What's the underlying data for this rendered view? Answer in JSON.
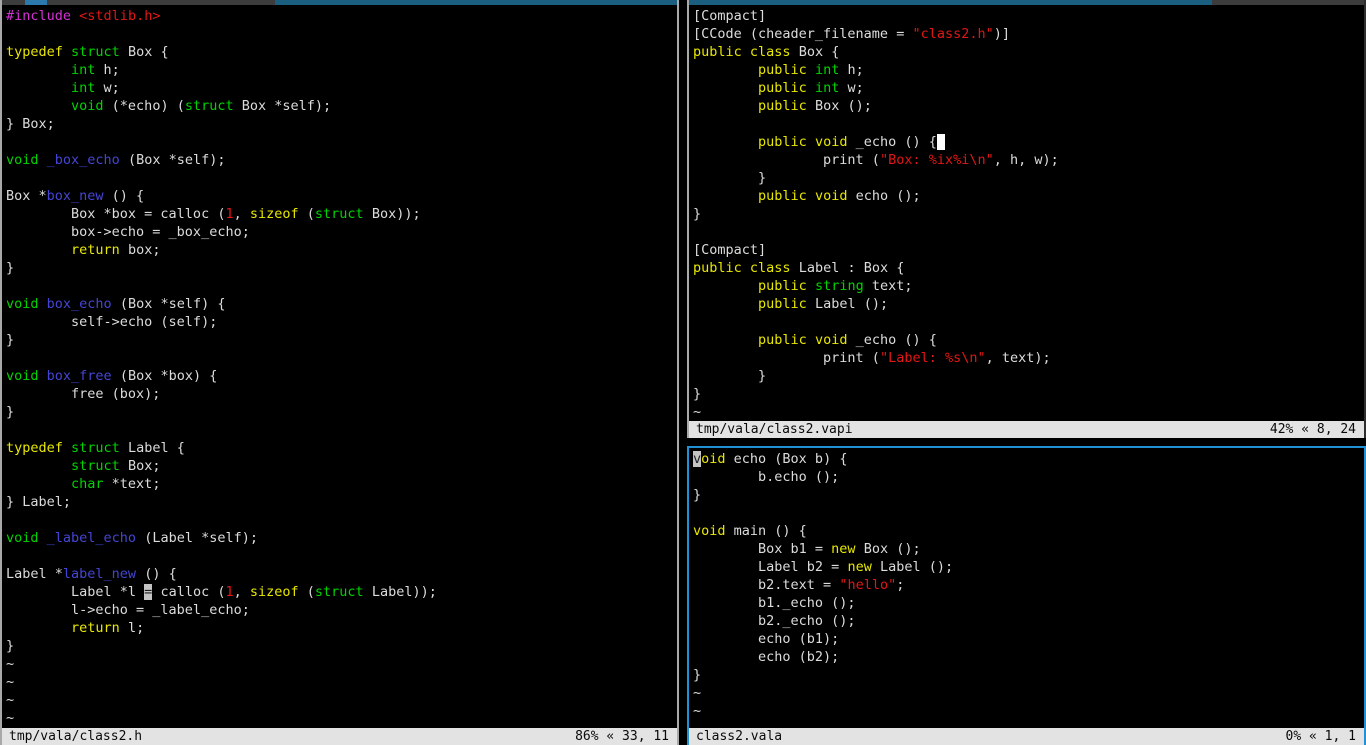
{
  "colors": {
    "background": "#000000",
    "default_text": "#dcdcdc",
    "syntax_magenta": "#d431d4",
    "syntax_red": "#e31616",
    "syntax_yellow": "#e8e800",
    "syntax_green": "#00d400",
    "syntax_blue": "#4545d5",
    "statusbar_bg": "#e3e3e3",
    "statusbar_text": "#0a0a0a",
    "active_pane_border": "#2191d6",
    "inactive_pane_border": "#a9a9a9",
    "top_strip_teal": "#1b5f80",
    "top_strip_blue": "#2b79ad",
    "top_strip_gray": "#3c3c3c",
    "cursor_inactive": "#c4c4c4",
    "cursor_active": "#ffffff"
  },
  "panes": {
    "left": {
      "status": {
        "file": "tmp/vala/class2.h",
        "position": "86% « 33, 11"
      },
      "lines": [
        [
          {
            "t": "#include",
            "c": "magenta"
          },
          {
            "t": " ",
            "c": "fg"
          },
          {
            "t": "<stdlib.h>",
            "c": "red"
          }
        ],
        [],
        [
          {
            "t": "typedef",
            "c": "yellow"
          },
          {
            "t": " ",
            "c": "fg"
          },
          {
            "t": "struct",
            "c": "green"
          },
          {
            "t": " Box {",
            "c": "fg"
          }
        ],
        [
          {
            "t": "        ",
            "c": "fg"
          },
          {
            "t": "int",
            "c": "green"
          },
          {
            "t": " h;",
            "c": "fg"
          }
        ],
        [
          {
            "t": "        ",
            "c": "fg"
          },
          {
            "t": "int",
            "c": "green"
          },
          {
            "t": " w;",
            "c": "fg"
          }
        ],
        [
          {
            "t": "        ",
            "c": "fg"
          },
          {
            "t": "void",
            "c": "green"
          },
          {
            "t": " (*echo) (",
            "c": "fg"
          },
          {
            "t": "struct",
            "c": "green"
          },
          {
            "t": " Box *self);",
            "c": "fg"
          }
        ],
        [
          {
            "t": "} Box;",
            "c": "fg"
          }
        ],
        [],
        [
          {
            "t": "void",
            "c": "green"
          },
          {
            "t": " ",
            "c": "fg"
          },
          {
            "t": "_box_echo",
            "c": "blue"
          },
          {
            "t": " (Box *self);",
            "c": "fg"
          }
        ],
        [],
        [
          {
            "t": "Box *",
            "c": "fg"
          },
          {
            "t": "box_new",
            "c": "blue"
          },
          {
            "t": " () {",
            "c": "fg"
          }
        ],
        [
          {
            "t": "        Box *box = calloc (",
            "c": "fg"
          },
          {
            "t": "1",
            "c": "red"
          },
          {
            "t": ", ",
            "c": "fg"
          },
          {
            "t": "sizeof",
            "c": "yellow"
          },
          {
            "t": " (",
            "c": "fg"
          },
          {
            "t": "struct",
            "c": "green"
          },
          {
            "t": " Box));",
            "c": "fg"
          }
        ],
        [
          {
            "t": "        box->echo = _box_echo;",
            "c": "fg"
          }
        ],
        [
          {
            "t": "        ",
            "c": "fg"
          },
          {
            "t": "return",
            "c": "yellow"
          },
          {
            "t": " box;",
            "c": "fg"
          }
        ],
        [
          {
            "t": "}",
            "c": "fg"
          }
        ],
        [],
        [
          {
            "t": "void",
            "c": "green"
          },
          {
            "t": " ",
            "c": "fg"
          },
          {
            "t": "box_echo",
            "c": "blue"
          },
          {
            "t": " (Box *self) {",
            "c": "fg"
          }
        ],
        [
          {
            "t": "        self->echo (self);",
            "c": "fg"
          }
        ],
        [
          {
            "t": "}",
            "c": "fg"
          }
        ],
        [],
        [
          {
            "t": "void",
            "c": "green"
          },
          {
            "t": " ",
            "c": "fg"
          },
          {
            "t": "box_free",
            "c": "blue"
          },
          {
            "t": " (Box *box) {",
            "c": "fg"
          }
        ],
        [
          {
            "t": "        free (box);",
            "c": "fg"
          }
        ],
        [
          {
            "t": "}",
            "c": "fg"
          }
        ],
        [],
        [
          {
            "t": "typedef",
            "c": "yellow"
          },
          {
            "t": " ",
            "c": "fg"
          },
          {
            "t": "struct",
            "c": "green"
          },
          {
            "t": " Label {",
            "c": "fg"
          }
        ],
        [
          {
            "t": "        ",
            "c": "fg"
          },
          {
            "t": "struct",
            "c": "green"
          },
          {
            "t": " Box;",
            "c": "fg"
          }
        ],
        [
          {
            "t": "        ",
            "c": "fg"
          },
          {
            "t": "char",
            "c": "green"
          },
          {
            "t": " *text;",
            "c": "fg"
          }
        ],
        [
          {
            "t": "} Label;",
            "c": "fg"
          }
        ],
        [],
        [
          {
            "t": "void",
            "c": "green"
          },
          {
            "t": " ",
            "c": "fg"
          },
          {
            "t": "_label_echo",
            "c": "blue"
          },
          {
            "t": " (Label *self);",
            "c": "fg"
          }
        ],
        [],
        [
          {
            "t": "Label *",
            "c": "fg"
          },
          {
            "t": "label_new",
            "c": "blue"
          },
          {
            "t": " () {",
            "c": "fg"
          }
        ],
        [
          {
            "t": "        Label *l ",
            "c": "fg"
          },
          {
            "t": "=",
            "c": "fg",
            "cursor": "gray"
          },
          {
            "t": " calloc (",
            "c": "fg"
          },
          {
            "t": "1",
            "c": "red"
          },
          {
            "t": ", ",
            "c": "fg"
          },
          {
            "t": "sizeof",
            "c": "yellow"
          },
          {
            "t": " (",
            "c": "fg"
          },
          {
            "t": "struct",
            "c": "green"
          },
          {
            "t": " Label));",
            "c": "fg"
          }
        ],
        [
          {
            "t": "        l->echo = _label_echo;",
            "c": "fg"
          }
        ],
        [
          {
            "t": "        ",
            "c": "fg"
          },
          {
            "t": "return",
            "c": "yellow"
          },
          {
            "t": " l;",
            "c": "fg"
          }
        ],
        [
          {
            "t": "}",
            "c": "fg"
          }
        ],
        [
          {
            "t": "~",
            "c": "fg"
          }
        ],
        [
          {
            "t": "~",
            "c": "fg"
          }
        ],
        [
          {
            "t": "~",
            "c": "fg"
          }
        ],
        [
          {
            "t": "~",
            "c": "fg"
          }
        ]
      ]
    },
    "top_right": {
      "status": {
        "file": "tmp/vala/class2.vapi",
        "position": "42% « 8, 24"
      },
      "lines": [
        [
          {
            "t": "[Compact]",
            "c": "fg"
          }
        ],
        [
          {
            "t": "[CCode (cheader_filename = ",
            "c": "fg"
          },
          {
            "t": "\"class2.h\"",
            "c": "red"
          },
          {
            "t": ")]",
            "c": "fg"
          }
        ],
        [
          {
            "t": "public",
            "c": "yellow"
          },
          {
            "t": " ",
            "c": "fg"
          },
          {
            "t": "class",
            "c": "yellow"
          },
          {
            "t": " Box {",
            "c": "fg"
          }
        ],
        [
          {
            "t": "        ",
            "c": "fg"
          },
          {
            "t": "public",
            "c": "yellow"
          },
          {
            "t": " ",
            "c": "fg"
          },
          {
            "t": "int",
            "c": "green"
          },
          {
            "t": " h;",
            "c": "fg"
          }
        ],
        [
          {
            "t": "        ",
            "c": "fg"
          },
          {
            "t": "public",
            "c": "yellow"
          },
          {
            "t": " ",
            "c": "fg"
          },
          {
            "t": "int",
            "c": "green"
          },
          {
            "t": " w;",
            "c": "fg"
          }
        ],
        [
          {
            "t": "        ",
            "c": "fg"
          },
          {
            "t": "public",
            "c": "yellow"
          },
          {
            "t": " Box ();",
            "c": "fg"
          }
        ],
        [],
        [
          {
            "t": "        ",
            "c": "fg"
          },
          {
            "t": "public",
            "c": "yellow"
          },
          {
            "t": " ",
            "c": "fg"
          },
          {
            "t": "void",
            "c": "yellow"
          },
          {
            "t": " _echo () {",
            "c": "fg"
          },
          {
            "t": " ",
            "c": "fg",
            "cursor": "white"
          }
        ],
        [
          {
            "t": "                print (",
            "c": "fg"
          },
          {
            "t": "\"Box: %ix%i\\n\"",
            "c": "red"
          },
          {
            "t": ", h, w);",
            "c": "fg"
          }
        ],
        [
          {
            "t": "        }",
            "c": "fg"
          }
        ],
        [
          {
            "t": "        ",
            "c": "fg"
          },
          {
            "t": "public",
            "c": "yellow"
          },
          {
            "t": " ",
            "c": "fg"
          },
          {
            "t": "void",
            "c": "yellow"
          },
          {
            "t": " echo ();",
            "c": "fg"
          }
        ],
        [
          {
            "t": "}",
            "c": "fg"
          }
        ],
        [],
        [
          {
            "t": "[Compact]",
            "c": "fg"
          }
        ],
        [
          {
            "t": "public",
            "c": "yellow"
          },
          {
            "t": " ",
            "c": "fg"
          },
          {
            "t": "class",
            "c": "yellow"
          },
          {
            "t": " Label : Box {",
            "c": "fg"
          }
        ],
        [
          {
            "t": "        ",
            "c": "fg"
          },
          {
            "t": "public",
            "c": "yellow"
          },
          {
            "t": " ",
            "c": "fg"
          },
          {
            "t": "string",
            "c": "green"
          },
          {
            "t": " text;",
            "c": "fg"
          }
        ],
        [
          {
            "t": "        ",
            "c": "fg"
          },
          {
            "t": "public",
            "c": "yellow"
          },
          {
            "t": " Label ();",
            "c": "fg"
          }
        ],
        [],
        [
          {
            "t": "        ",
            "c": "fg"
          },
          {
            "t": "public",
            "c": "yellow"
          },
          {
            "t": " ",
            "c": "fg"
          },
          {
            "t": "void",
            "c": "yellow"
          },
          {
            "t": " _echo () {",
            "c": "fg"
          }
        ],
        [
          {
            "t": "                print (",
            "c": "fg"
          },
          {
            "t": "\"Label: %s\\n\"",
            "c": "red"
          },
          {
            "t": ", text);",
            "c": "fg"
          }
        ],
        [
          {
            "t": "        }",
            "c": "fg"
          }
        ],
        [
          {
            "t": "}",
            "c": "fg"
          }
        ],
        [
          {
            "t": "~",
            "c": "fg"
          }
        ]
      ]
    },
    "bottom_right": {
      "status": {
        "file": "class2.vala",
        "position": "0% « 1, 1"
      },
      "lines": [
        [
          {
            "t": "v",
            "c": "yellow",
            "cursor": "gray"
          },
          {
            "t": "oid",
            "c": "yellow"
          },
          {
            "t": " echo (Box b) {",
            "c": "fg"
          }
        ],
        [
          {
            "t": "        b.echo ();",
            "c": "fg"
          }
        ],
        [
          {
            "t": "}",
            "c": "fg"
          }
        ],
        [],
        [
          {
            "t": "void",
            "c": "yellow"
          },
          {
            "t": " main () {",
            "c": "fg"
          }
        ],
        [
          {
            "t": "        Box b1 = ",
            "c": "fg"
          },
          {
            "t": "new",
            "c": "yellow"
          },
          {
            "t": " Box ();",
            "c": "fg"
          }
        ],
        [
          {
            "t": "        Label b2 = ",
            "c": "fg"
          },
          {
            "t": "new",
            "c": "yellow"
          },
          {
            "t": " Label ();",
            "c": "fg"
          }
        ],
        [
          {
            "t": "        b2.text = ",
            "c": "fg"
          },
          {
            "t": "\"hello\"",
            "c": "red"
          },
          {
            "t": ";",
            "c": "fg"
          }
        ],
        [
          {
            "t": "        b1._echo ();",
            "c": "fg"
          }
        ],
        [
          {
            "t": "        b2._echo ();",
            "c": "fg"
          }
        ],
        [
          {
            "t": "        echo (b1);",
            "c": "fg"
          }
        ],
        [
          {
            "t": "        echo (b2);",
            "c": "fg"
          }
        ],
        [
          {
            "t": "}",
            "c": "fg"
          }
        ],
        [
          {
            "t": "~",
            "c": "fg"
          }
        ],
        [
          {
            "t": "~",
            "c": "fg"
          }
        ]
      ]
    }
  }
}
